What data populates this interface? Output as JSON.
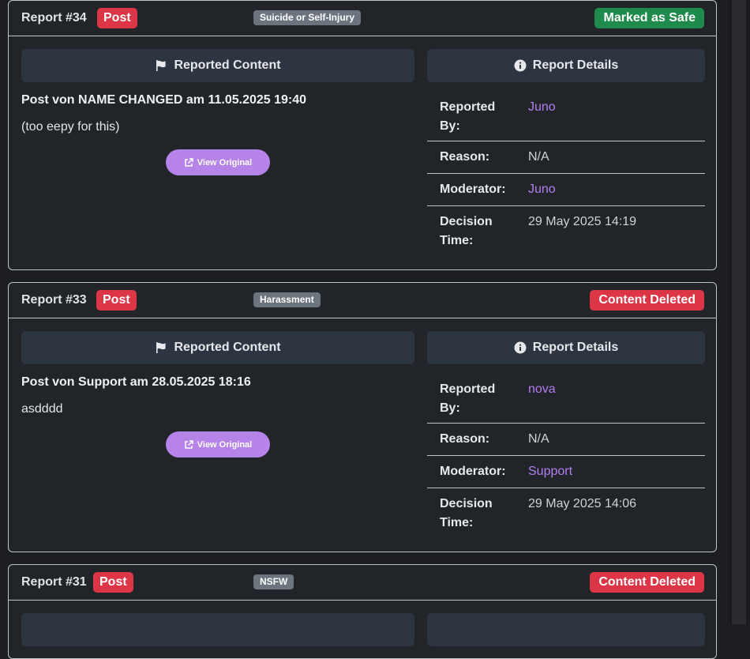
{
  "labels": {
    "reported_content": "Reported Content",
    "report_details": "Report Details",
    "view_original": "View Original",
    "reported_by": "Reported By:",
    "reason": "Reason:",
    "moderator": "Moderator:",
    "decision_time": "Decision Time:"
  },
  "colors": {
    "status_safe": "#1e8a4c",
    "status_deleted": "#dc3545",
    "type_post": "#dc3545",
    "link": "#b27ff0",
    "button": "#b683e8"
  },
  "reports": [
    {
      "id": "Report #34",
      "type": "Post",
      "category": "Suicide or Self-Injury",
      "status": "Marked as Safe",
      "post_title": "Post von NAME CHANGED am 11.05.2025 19:40",
      "post_body": "(too eepy for this)",
      "reported_by": "Juno",
      "reason": "N/A",
      "moderator": "Juno",
      "decision_time": "29 May 2025 14:19"
    },
    {
      "id": "Report #33",
      "type": "Post",
      "category": "Harassment",
      "status": "Content Deleted",
      "post_title": "Post von Support am 28.05.2025 18:16",
      "post_body": "asdddd",
      "reported_by": "nova",
      "reason": "N/A",
      "moderator": "Support",
      "decision_time": "29 May 2025 14:06"
    },
    {
      "id": "Report #31",
      "type": "Post",
      "category": "NSFW",
      "status": "Content Deleted"
    }
  ]
}
